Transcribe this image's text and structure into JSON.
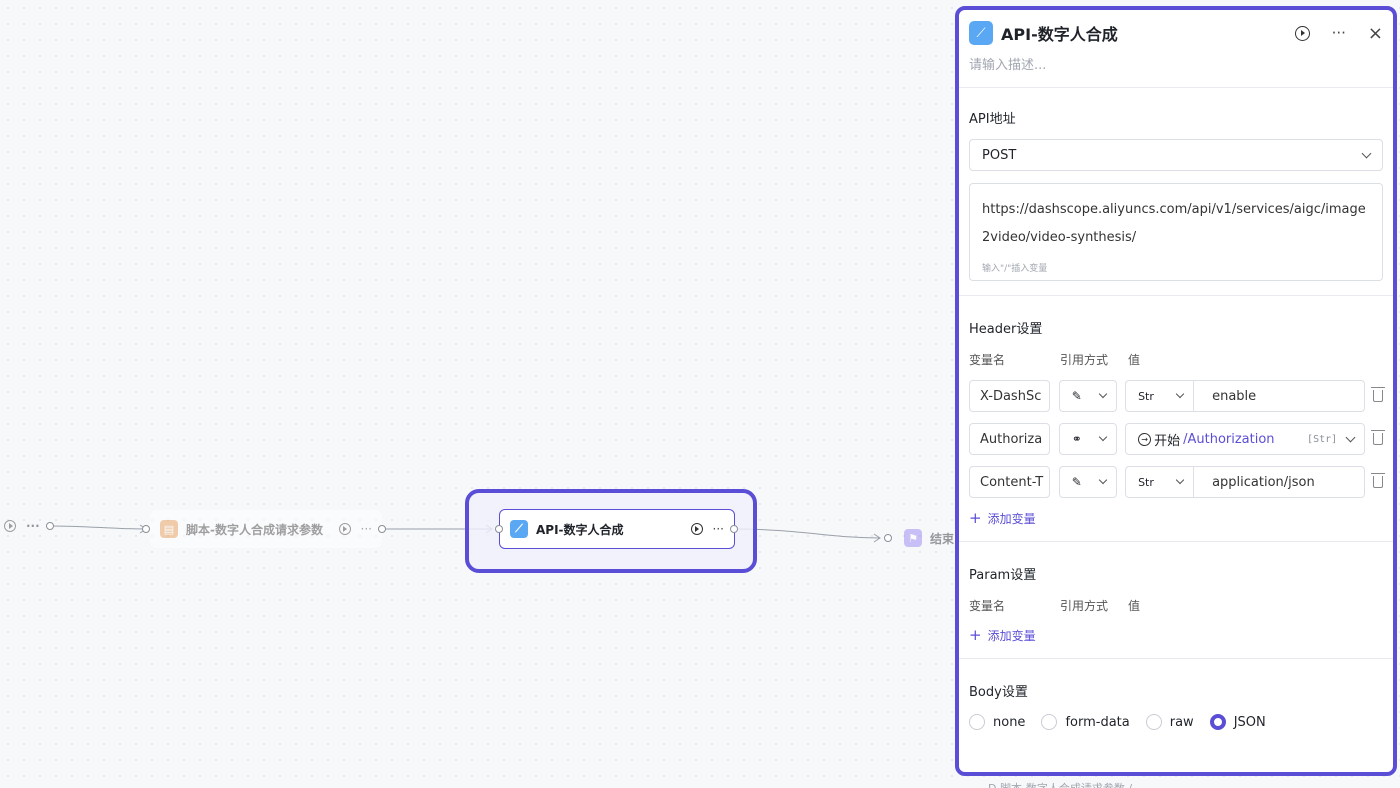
{
  "canvas": {
    "node_script": {
      "label": "脚本-数字人合成请求参数",
      "more": "···"
    },
    "node_api": {
      "label": "API-数字人合成",
      "more": "···"
    },
    "node_end": {
      "label": "结束"
    },
    "node_left": {
      "more": "···"
    }
  },
  "panel": {
    "title": "API-数字人合成",
    "more": "···",
    "close": "×",
    "desc_placeholder": "请输入描述...",
    "api": {
      "section_title": "API地址",
      "method": "POST",
      "url": "https://dashscope.aliyuncs.com/api/v1/services/aigc/image2video/video-synthesis/",
      "url_hint": "输入\"/\"插入变量"
    },
    "header": {
      "section_title": "Header设置",
      "col_name": "变量名",
      "col_ref": "引用方式",
      "col_value": "值",
      "rows": [
        {
          "name": "X-DashSc",
          "ref_icon": "pen-icon",
          "type": "Str",
          "value": "enable"
        },
        {
          "name": "Authoriza",
          "ref_icon": "link-icon",
          "ref_node": "开始",
          "ref_path": "/Authorization",
          "ref_type": "[Str]"
        },
        {
          "name": "Content-T",
          "ref_icon": "pen-icon",
          "type": "Str",
          "value": "application/json"
        }
      ],
      "add_label": "添加变量"
    },
    "param": {
      "section_title": "Param设置",
      "col_name": "变量名",
      "col_ref": "引用方式",
      "col_value": "值",
      "add_label": "添加变量"
    },
    "body": {
      "section_title": "Body设置",
      "options": [
        "none",
        "form-data",
        "raw",
        "JSON"
      ],
      "selected": "JSON"
    }
  },
  "below_panel": "D 脚本-数字人合成请求参数 /"
}
